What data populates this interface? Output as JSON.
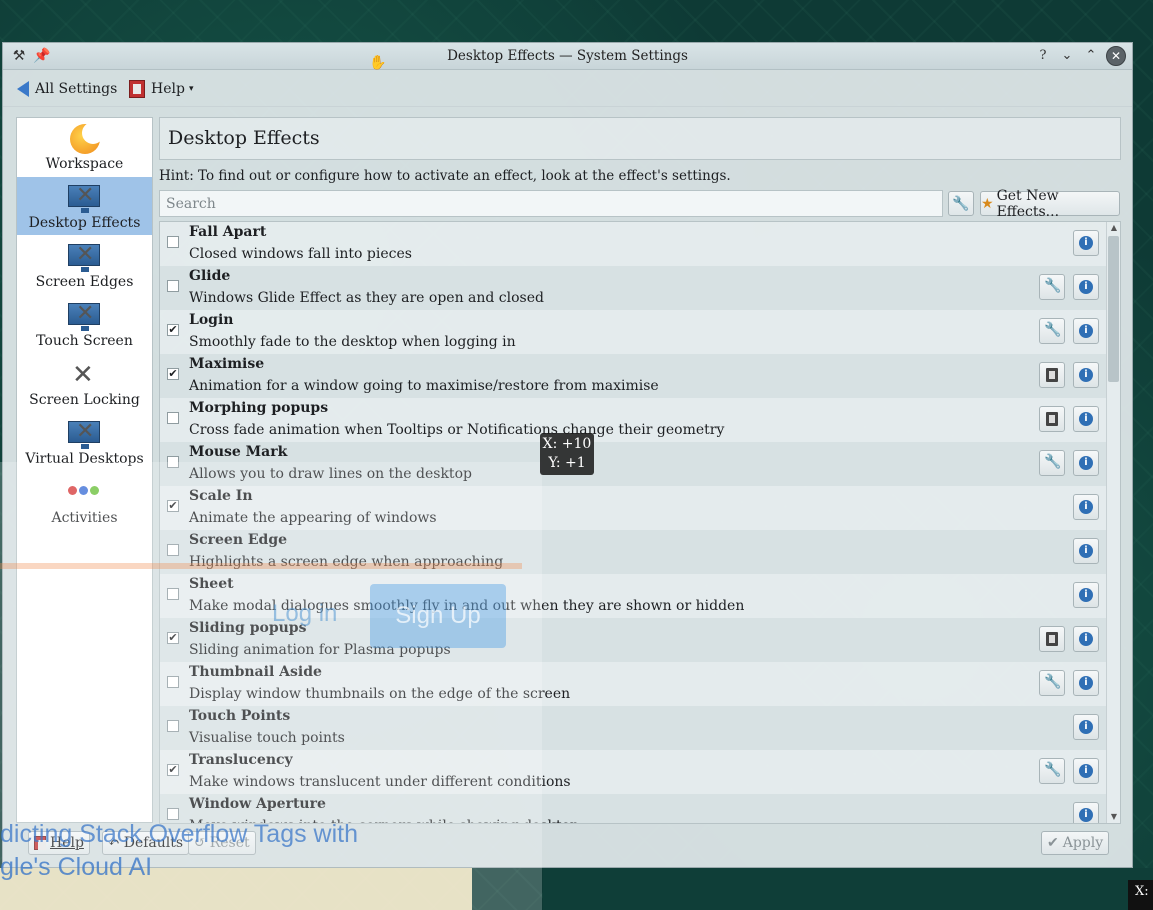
{
  "window": {
    "title": "Desktop Effects — System Settings",
    "buttons": {
      "help": "?",
      "minimize": "⌄",
      "maximize": "⌃",
      "close": "✕"
    }
  },
  "toolbar": {
    "all_settings": "All Settings",
    "help": "Help"
  },
  "sidebar": {
    "items": [
      {
        "label": "Workspace",
        "icon": "workspace-icon",
        "active": false
      },
      {
        "label": "Desktop Effects",
        "icon": "desktop-effects-icon",
        "active": true
      },
      {
        "label": "Screen Edges",
        "icon": "screen-edges-icon",
        "active": false
      },
      {
        "label": "Touch Screen",
        "icon": "touch-screen-icon",
        "active": false
      },
      {
        "label": "Screen Locking",
        "icon": "screen-locking-icon",
        "active": false
      },
      {
        "label": "Virtual Desktops",
        "icon": "virtual-desktops-icon",
        "active": false
      },
      {
        "label": "Activities",
        "icon": "activities-icon",
        "active": false
      }
    ]
  },
  "main": {
    "title": "Desktop Effects",
    "hint": "Hint: To find out or configure how to activate an effect, look at the effect's settings.",
    "search_placeholder": "Search",
    "get_new_effects": "Get New Effects...",
    "effects": [
      {
        "name": "Fall Apart",
        "description": "Closed windows fall into pieces",
        "checked": false,
        "configure": null
      },
      {
        "name": "Glide",
        "description": "Windows Glide Effect as they are open and closed",
        "checked": false,
        "configure": "wrench"
      },
      {
        "name": "Login",
        "description": "Smoothly fade to the desktop when logging in",
        "checked": true,
        "configure": "wrench"
      },
      {
        "name": "Maximise",
        "description": "Animation for a window going to maximise/restore from maximise",
        "checked": true,
        "configure": "video"
      },
      {
        "name": "Morphing popups",
        "description": "Cross fade animation when Tooltips or Notifications change their geometry",
        "checked": false,
        "configure": "video"
      },
      {
        "name": "Mouse Mark",
        "description": "Allows you to draw lines on the desktop",
        "checked": false,
        "configure": "wrench"
      },
      {
        "name": "Scale In",
        "description": "Animate the appearing of windows",
        "checked": true,
        "configure": null
      },
      {
        "name": "Screen Edge",
        "description": "Highlights a screen edge when approaching",
        "checked": false,
        "configure": null
      },
      {
        "name": "Sheet",
        "description": "Make modal dialogues smoothly fly in and out when they are shown or hidden",
        "checked": false,
        "configure": null
      },
      {
        "name": "Sliding popups",
        "description": "Sliding animation for Plasma popups",
        "checked": true,
        "configure": "video"
      },
      {
        "name": "Thumbnail Aside",
        "description": "Display window thumbnails on the edge of the screen",
        "checked": false,
        "configure": "wrench"
      },
      {
        "name": "Touch Points",
        "description": "Visualise touch points",
        "checked": false,
        "configure": null
      },
      {
        "name": "Translucency",
        "description": "Make windows translucent under different conditions",
        "checked": true,
        "configure": "wrench"
      },
      {
        "name": "Window Aperture",
        "description": "Move windows into the corners while showing desktop",
        "checked": false,
        "configure": null
      }
    ]
  },
  "footer": {
    "help": "Help",
    "defaults": "Defaults",
    "reset": "Reset",
    "apply": "Apply"
  },
  "tooltip": {
    "x": "X: +10",
    "y": "Y: +1"
  },
  "background": {
    "login": "Log in",
    "signup": "Sign Up",
    "article_line1": "dicting Stack Overflow Tags with",
    "article_line2": "gle's Cloud AI",
    "corner": "X:"
  },
  "colors": {
    "accent": "#9fc3e8",
    "info": "#2f6fb5",
    "selection": "#3a79c9"
  }
}
